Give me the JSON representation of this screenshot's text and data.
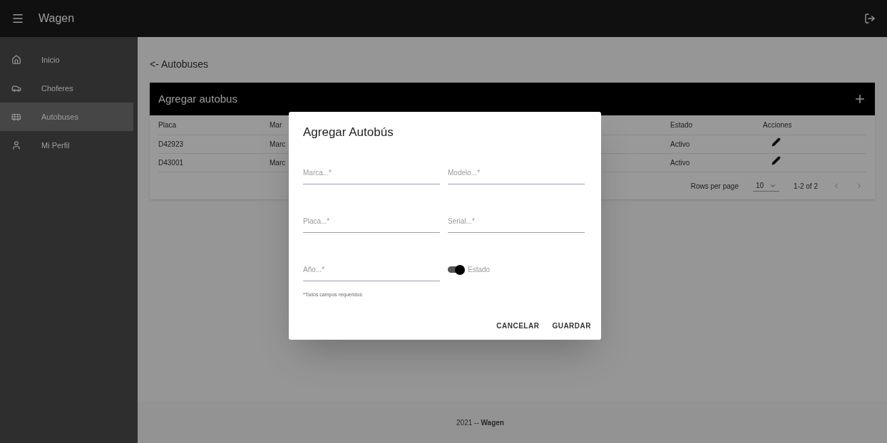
{
  "app_bar": {
    "title": "Wagen"
  },
  "sidebar": {
    "items": [
      {
        "label": "Inicio",
        "kind": "home",
        "selected": false
      },
      {
        "label": "Choferes",
        "kind": "car",
        "selected": false
      },
      {
        "label": "Autobuses",
        "kind": "bus",
        "selected": true
      },
      {
        "label": "Mi Perfil",
        "kind": "person",
        "selected": false
      }
    ]
  },
  "breadcrumb": "<- Autobuses",
  "card": {
    "title": "Agregar autobus",
    "table": {
      "columns": [
        "Placa",
        "Mar",
        "Estado",
        "Acciones"
      ],
      "rows": [
        {
          "cells": [
            "D42923",
            "Marc",
            "Activo"
          ]
        },
        {
          "cells": [
            "D43001",
            "Marc",
            "Activo"
          ]
        }
      ]
    },
    "pagination": {
      "rows_per_page_label": "Rows per page",
      "rows_per_page": "10",
      "range": "1-2 of 2"
    }
  },
  "dialog": {
    "title": "Agregar Autobús",
    "fields": [
      {
        "kind": "text",
        "placeholder": "Marca...*"
      },
      {
        "kind": "text",
        "placeholder": "Modelo...*"
      },
      {
        "kind": "text",
        "placeholder": "Placa...*"
      },
      {
        "kind": "text",
        "placeholder": "Serial...*"
      },
      {
        "kind": "text",
        "placeholder": "Año...*"
      },
      {
        "kind": "switch",
        "label": "Estado",
        "on": true
      }
    ],
    "helper": "*Todos campos requeridos",
    "buttons": [
      "CANCELAR",
      "GUARDAR"
    ]
  },
  "footer": "2021 -- **Wagen**"
}
